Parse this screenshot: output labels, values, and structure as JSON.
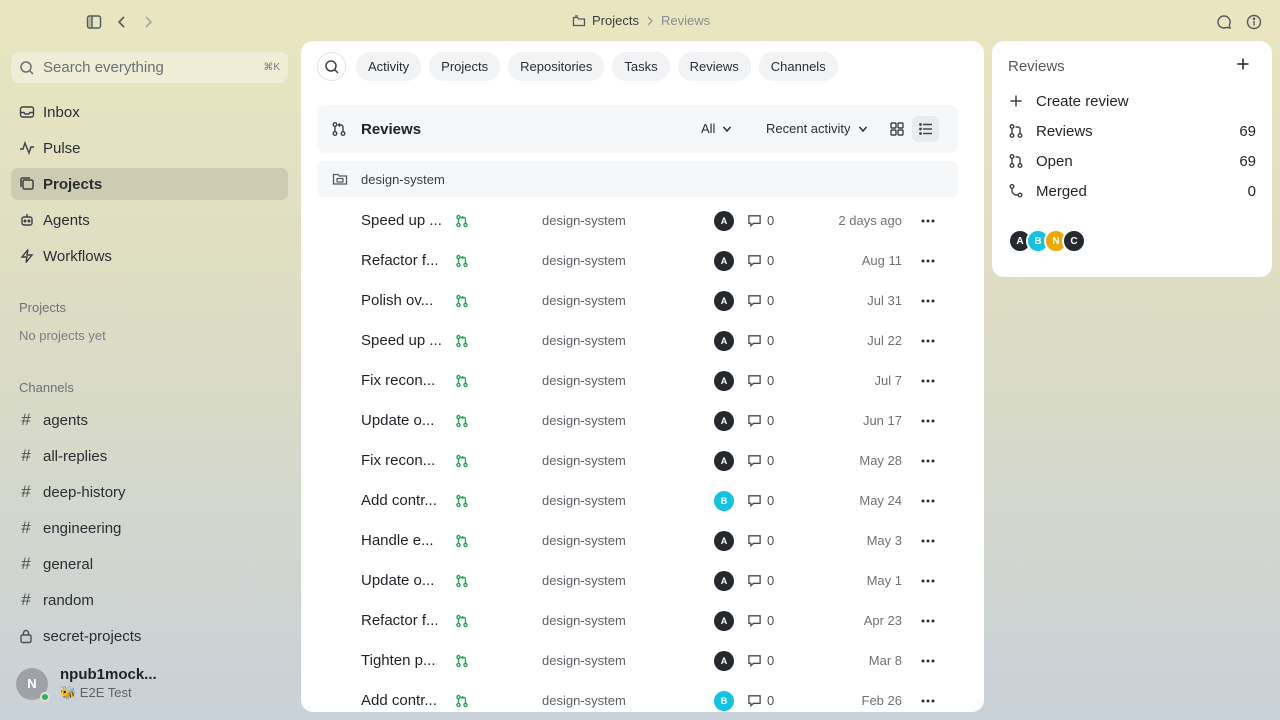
{
  "topbar": {
    "breadcrumb": [
      "Projects",
      "Reviews"
    ]
  },
  "sidebar": {
    "search_placeholder": "Search everything",
    "search_shortcut": "⌘K",
    "nav": [
      {
        "label": "Inbox",
        "icon": "inbox-icon"
      },
      {
        "label": "Pulse",
        "icon": "pulse-icon"
      },
      {
        "label": "Projects",
        "icon": "projects-icon",
        "active": true
      },
      {
        "label": "Agents",
        "icon": "agents-icon"
      },
      {
        "label": "Workflows",
        "icon": "workflows-icon"
      }
    ],
    "projects_title": "Projects",
    "projects_empty": "No projects yet",
    "channels_title": "Channels",
    "channels": [
      {
        "label": "agents",
        "icon": "hash-icon"
      },
      {
        "label": "all-replies",
        "icon": "hash-icon"
      },
      {
        "label": "deep-history",
        "icon": "hash-icon"
      },
      {
        "label": "engineering",
        "icon": "hash-icon"
      },
      {
        "label": "general",
        "icon": "hash-icon"
      },
      {
        "label": "random",
        "icon": "hash-icon"
      },
      {
        "label": "secret-projects",
        "icon": "lock-icon"
      }
    ],
    "user": {
      "initial": "N",
      "name": "npub1mock...",
      "status": "🐝 E2E Test",
      "online_color": "#27b36b"
    }
  },
  "main": {
    "tabs": [
      "Activity",
      "Projects",
      "Repositories",
      "Tasks",
      "Reviews",
      "Channels"
    ],
    "header": {
      "title": "Reviews",
      "filter": "All",
      "sort": "Recent activity"
    },
    "group": "design-system",
    "rows": [
      {
        "title": "Speed up ...",
        "repo": "design-system",
        "author": "A",
        "author_color": "#26292e",
        "comments": "0",
        "date": "2 days ago"
      },
      {
        "title": "Refactor f...",
        "repo": "design-system",
        "author": "A",
        "author_color": "#26292e",
        "comments": "0",
        "date": "Aug 11"
      },
      {
        "title": "Polish ov...",
        "repo": "design-system",
        "author": "A",
        "author_color": "#26292e",
        "comments": "0",
        "date": "Jul 31"
      },
      {
        "title": "Speed up ...",
        "repo": "design-system",
        "author": "A",
        "author_color": "#26292e",
        "comments": "0",
        "date": "Jul 22"
      },
      {
        "title": "Fix recon...",
        "repo": "design-system",
        "author": "A",
        "author_color": "#26292e",
        "comments": "0",
        "date": "Jul 7"
      },
      {
        "title": "Update o...",
        "repo": "design-system",
        "author": "A",
        "author_color": "#26292e",
        "comments": "0",
        "date": "Jun 17"
      },
      {
        "title": "Fix recon...",
        "repo": "design-system",
        "author": "A",
        "author_color": "#26292e",
        "comments": "0",
        "date": "May 28"
      },
      {
        "title": "Add contr...",
        "repo": "design-system",
        "author": "B",
        "author_color": "#13c3df",
        "comments": "0",
        "date": "May 24"
      },
      {
        "title": "Handle e...",
        "repo": "design-system",
        "author": "A",
        "author_color": "#26292e",
        "comments": "0",
        "date": "May 3"
      },
      {
        "title": "Update o...",
        "repo": "design-system",
        "author": "A",
        "author_color": "#26292e",
        "comments": "0",
        "date": "May 1"
      },
      {
        "title": "Refactor f...",
        "repo": "design-system",
        "author": "A",
        "author_color": "#26292e",
        "comments": "0",
        "date": "Apr 23"
      },
      {
        "title": "Tighten p...",
        "repo": "design-system",
        "author": "A",
        "author_color": "#26292e",
        "comments": "0",
        "date": "Mar 8"
      },
      {
        "title": "Add contr...",
        "repo": "design-system",
        "author": "B",
        "author_color": "#13c3df",
        "comments": "0",
        "date": "Feb 26"
      }
    ]
  },
  "rpanel": {
    "title": "Reviews",
    "create_label": "Create review",
    "stats": [
      {
        "label": "Reviews",
        "count": "69",
        "icon": "pull-request-icon"
      },
      {
        "label": "Open",
        "count": "69",
        "icon": "pull-request-icon"
      },
      {
        "label": "Merged",
        "count": "0",
        "icon": "merge-icon"
      }
    ],
    "avatars": [
      {
        "initial": "A",
        "color": "#26292e"
      },
      {
        "initial": "B",
        "color": "#13c3df"
      },
      {
        "initial": "N",
        "color": "#f0a800"
      },
      {
        "initial": "C",
        "color": "#26292e"
      }
    ]
  },
  "colors": {
    "accent_green": "#2ea35a",
    "active_bg": "#d6d5bf"
  }
}
